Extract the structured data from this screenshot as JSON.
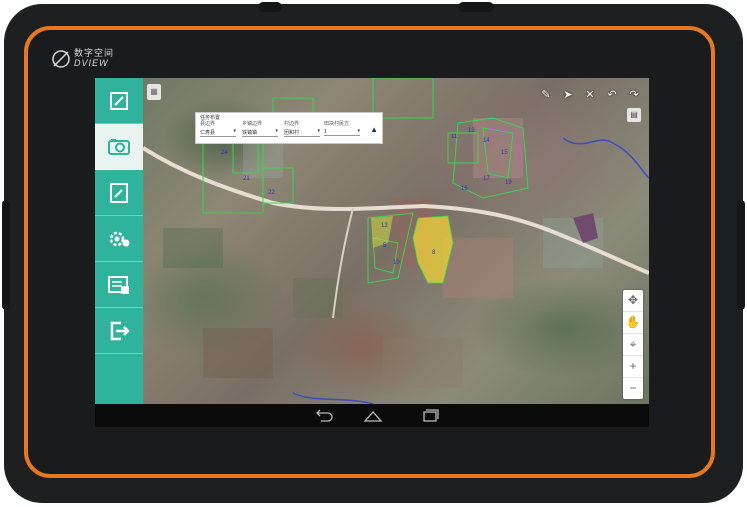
{
  "brand": {
    "logo_cn": "数字空间",
    "logo_en": "DVIEW"
  },
  "sidebar": {
    "items": [
      {
        "name": "edit-note",
        "icon": "pencil-square-icon"
      },
      {
        "name": "camera",
        "icon": "camera-icon",
        "active": true
      },
      {
        "name": "clipboard-edit",
        "icon": "clipboard-edit-icon"
      },
      {
        "name": "settings",
        "icon": "gear-icon"
      },
      {
        "name": "report",
        "icon": "document-list-icon"
      },
      {
        "name": "exit",
        "icon": "exit-icon"
      }
    ]
  },
  "panel": {
    "title": "任务布置",
    "columns": [
      {
        "label": "县边界",
        "value": "仁寿县"
      },
      {
        "label": "乡镇边界",
        "value": "铁镇镇"
      },
      {
        "label": "村边界",
        "value": "团和村"
      },
      {
        "label": "田块村民方",
        "value": "1"
      }
    ]
  },
  "map": {
    "parcel_labels": [
      "11",
      "13",
      "14",
      "15",
      "16",
      "17",
      "19",
      "21",
      "22",
      "24",
      "10",
      "5",
      "8",
      "12"
    ],
    "colors": {
      "boundary": "#2fe04a",
      "parcel_fill_yellow": "#f0d23a",
      "road": "#e8ddd2",
      "river": "#3d4cc0"
    }
  },
  "toolbar": {
    "tools": [
      "pen-icon",
      "pointer-icon",
      "close-icon",
      "undo-icon",
      "redo-icon"
    ]
  },
  "zoom": {
    "buttons": [
      "pan-icon",
      "hand-icon",
      "locate-icon",
      "zoom-in-icon",
      "zoom-out-icon"
    ]
  },
  "navbar": {
    "buttons": [
      "back-icon",
      "home-icon",
      "recent-apps-icon"
    ]
  },
  "colors": {
    "accent": "#2fb39d",
    "frame": "#e87820",
    "device": "#1e1f21"
  }
}
